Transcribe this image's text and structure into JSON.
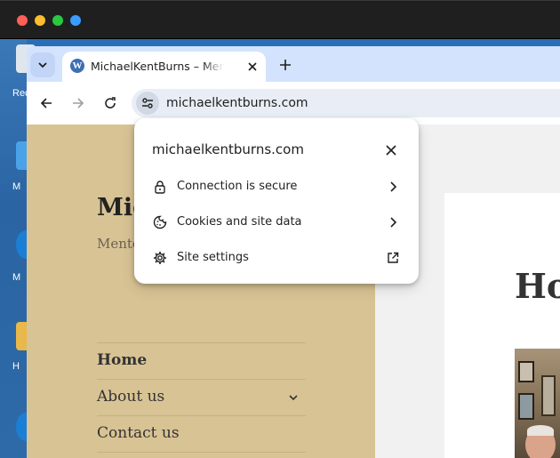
{
  "browser": {
    "tab": {
      "title": "MichaelKentBurns – Mentoring"
    },
    "address_bar": {
      "url": "michaelkentburns.com"
    }
  },
  "page": {
    "site_title": "Mic",
    "tagline": "Mento develo",
    "menu": [
      {
        "label": "Home",
        "active": true
      },
      {
        "label": "About us",
        "has_submenu": true
      },
      {
        "label": "Contact us"
      }
    ],
    "main_heading": "Ho"
  },
  "site_info_popup": {
    "domain": "michaelkentburns.com",
    "items": [
      {
        "label": "Connection is secure",
        "icon": "lock-icon",
        "trailing": "chevron-right-icon"
      },
      {
        "label": "Cookies and site data",
        "icon": "cookie-icon",
        "trailing": "chevron-right-icon"
      },
      {
        "label": "Site settings",
        "icon": "gear-icon",
        "trailing": "external-link-icon"
      }
    ]
  },
  "desktop": {
    "labels": [
      "Rec",
      "M",
      "M",
      "H"
    ]
  },
  "colors": {
    "tabstrip": "#d3e3fd",
    "omnibox": "#e9eef6",
    "sidebar": "#d8c394",
    "traffic_close": "#fe5f57",
    "traffic_minimize": "#febc2e",
    "traffic_maximize": "#28c840"
  }
}
